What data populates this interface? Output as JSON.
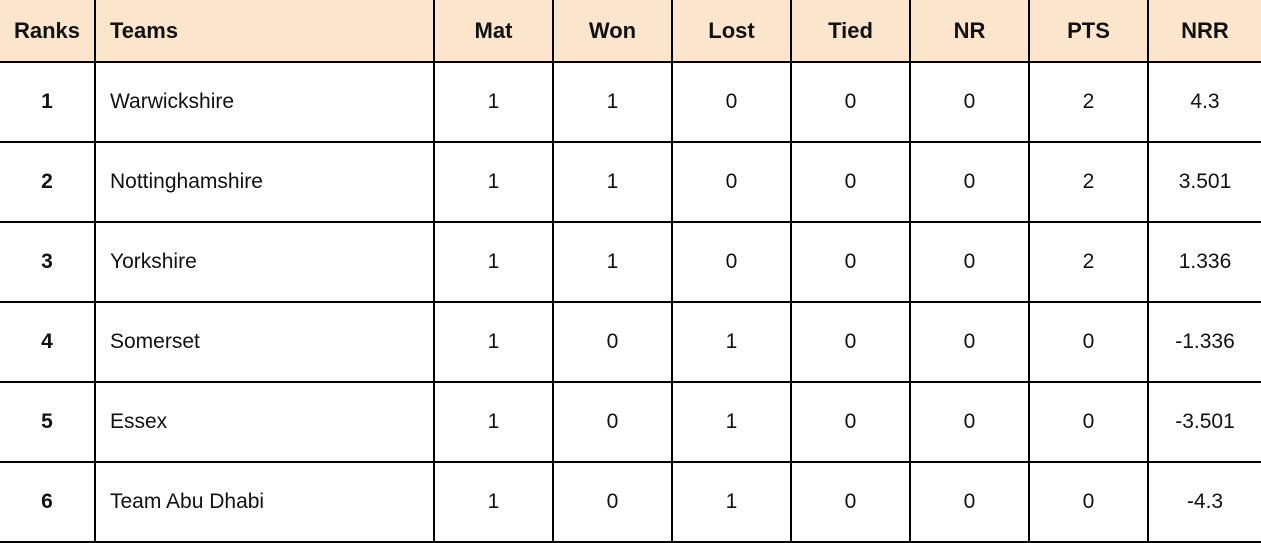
{
  "table": {
    "name": "points-table",
    "header_bg": "#FCE5CD",
    "border_color": "#000000",
    "columns": [
      {
        "key": "rank",
        "label": "Ranks",
        "align": "center"
      },
      {
        "key": "team",
        "label": "Teams",
        "align": "left"
      },
      {
        "key": "mat",
        "label": "Mat",
        "align": "center"
      },
      {
        "key": "won",
        "label": "Won",
        "align": "center"
      },
      {
        "key": "lost",
        "label": "Lost",
        "align": "center"
      },
      {
        "key": "tied",
        "label": "Tied",
        "align": "center"
      },
      {
        "key": "nr",
        "label": "NR",
        "align": "center"
      },
      {
        "key": "pts",
        "label": "PTS",
        "align": "center"
      },
      {
        "key": "nrr",
        "label": "NRR",
        "align": "center"
      }
    ],
    "rows": [
      {
        "rank": "1",
        "team": "Warwickshire",
        "mat": "1",
        "won": "1",
        "lost": "0",
        "tied": "0",
        "nr": "0",
        "pts": "2",
        "nrr": "4.3"
      },
      {
        "rank": "2",
        "team": "Nottinghamshire",
        "mat": "1",
        "won": "1",
        "lost": "0",
        "tied": "0",
        "nr": "0",
        "pts": "2",
        "nrr": "3.501"
      },
      {
        "rank": "3",
        "team": "Yorkshire",
        "mat": "1",
        "won": "1",
        "lost": "0",
        "tied": "0",
        "nr": "0",
        "pts": "2",
        "nrr": "1.336"
      },
      {
        "rank": "4",
        "team": "Somerset",
        "mat": "1",
        "won": "0",
        "lost": "1",
        "tied": "0",
        "nr": "0",
        "pts": "0",
        "nrr": "-1.336"
      },
      {
        "rank": "5",
        "team": "Essex",
        "mat": "1",
        "won": "0",
        "lost": "1",
        "tied": "0",
        "nr": "0",
        "pts": "0",
        "nrr": "-3.501"
      },
      {
        "rank": "6",
        "team": "Team Abu Dhabi",
        "mat": "1",
        "won": "0",
        "lost": "1",
        "tied": "0",
        "nr": "0",
        "pts": "0",
        "nrr": "-4.3"
      }
    ]
  }
}
